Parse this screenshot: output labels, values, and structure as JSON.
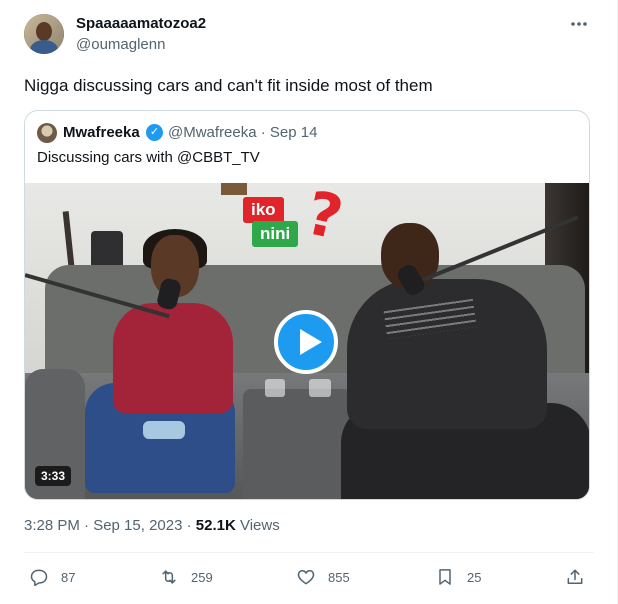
{
  "author": {
    "display_name": "Spaaaaamatozoa2",
    "handle": "@oumaglenn"
  },
  "more_icon": "ellipsis-icon",
  "tweet_text": "Nigga discussing cars and can't fit inside most of them",
  "quoted": {
    "display_name": "Mwafreeka",
    "handle_date": "@Mwafreeka · Sep 14",
    "verified_icon": "verified-badge-icon",
    "text": "Discussing cars with @CBBT_TV",
    "video": {
      "duration": "3:33",
      "overlay_word_1": "iko",
      "overlay_word_2": "nini",
      "overlay_symbol": "?"
    }
  },
  "meta": {
    "timestamp": "3:28 PM · Sep 15, 2023 ·",
    "views_count": "52.1K",
    "views_label": "Views"
  },
  "actions": {
    "reply": "87",
    "retweet": "259",
    "like": "855",
    "bookmark": "25"
  },
  "colors": {
    "accent": "#1d9bf0",
    "muted_text": "#536471",
    "border": "#cfd9de"
  }
}
